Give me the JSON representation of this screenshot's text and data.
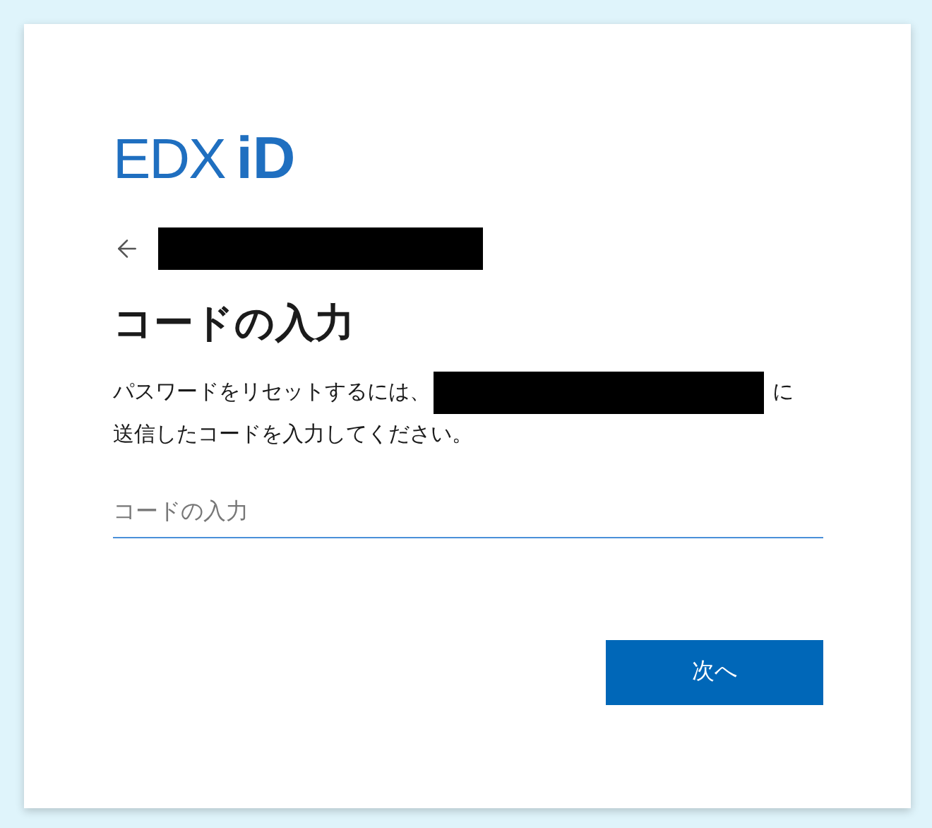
{
  "logo": {
    "word": "EDX",
    "mark": "iD"
  },
  "back": {
    "redacted": true
  },
  "title": "コードの入力",
  "description": {
    "before": "パスワードをリセットするには、",
    "redacted": true,
    "after": "に",
    "line2": "送信したコードを入力してください。"
  },
  "code_field": {
    "placeholder": "コードの入力"
  },
  "buttons": [
    {
      "label": "次へ",
      "kind": "primary"
    }
  ]
}
